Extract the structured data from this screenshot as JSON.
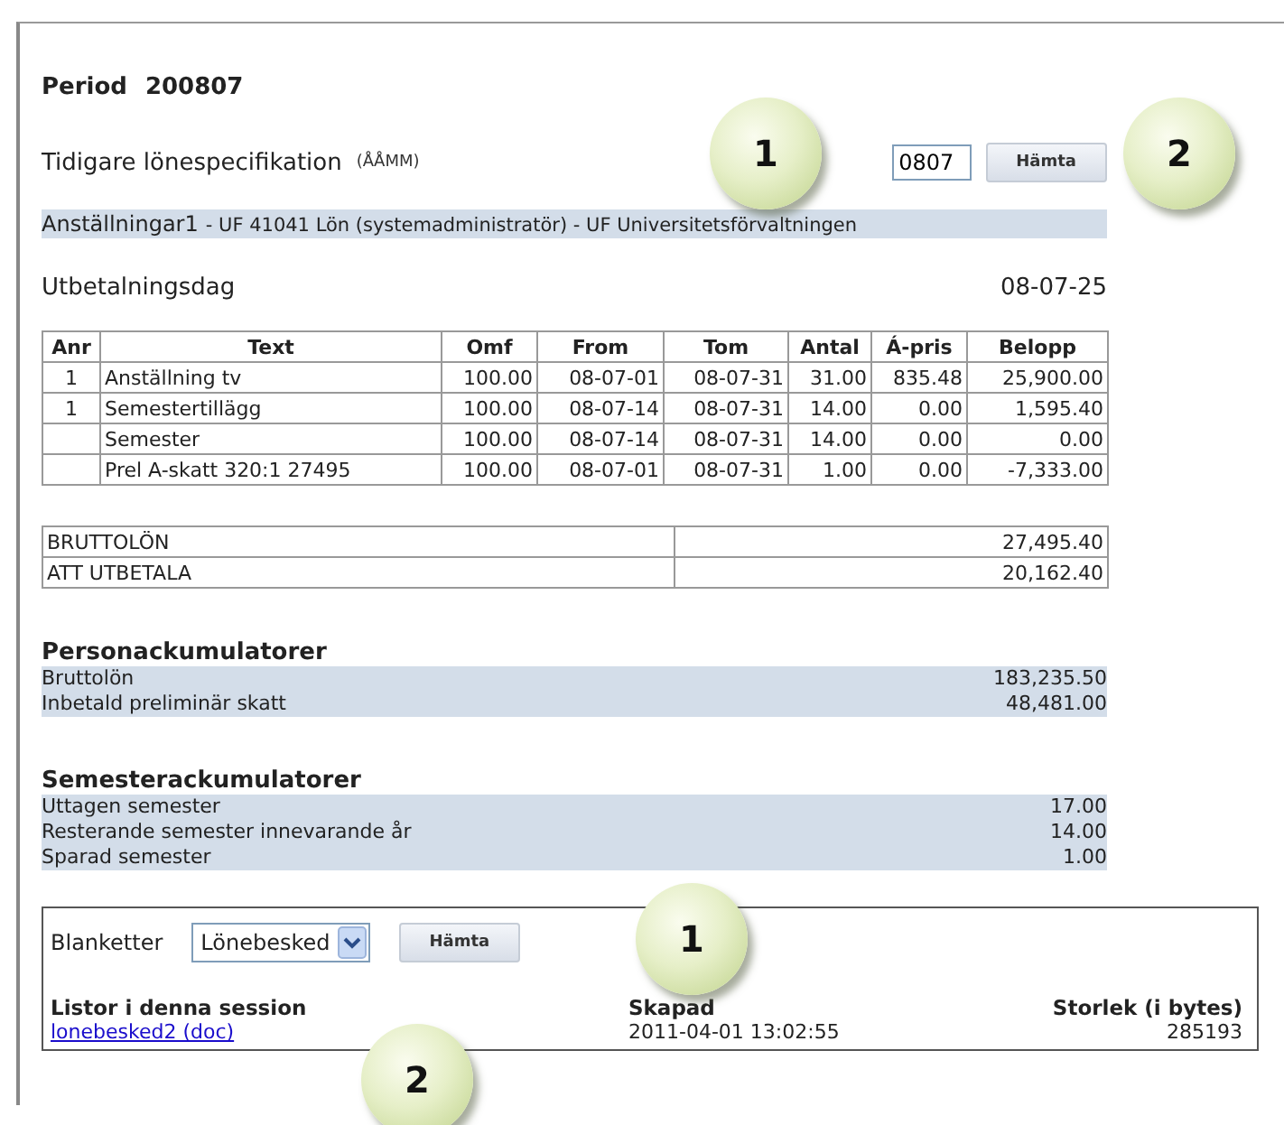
{
  "period": {
    "label": "Period",
    "value": "200807"
  },
  "earlier": {
    "label": "Tidigare lönespecifikation",
    "hint": "(ÅÅMM)",
    "value": "0807",
    "button": "Hämta"
  },
  "employment": {
    "title": "Anställningar1",
    "detail": "- UF 41041 Lön (systemadministratör) - UF Universitetsförvaltningen"
  },
  "payday": {
    "label": "Utbetalningsdag",
    "value": "08-07-25"
  },
  "table": {
    "columns": [
      "Anr",
      "Text",
      "Omf",
      "From",
      "Tom",
      "Antal",
      "Á-pris",
      "Belopp"
    ],
    "rows": [
      [
        "1",
        "Anställning tv",
        "100.00",
        "08-07-01",
        "08-07-31",
        "31.00",
        "835.48",
        "25,900.00"
      ],
      [
        "1",
        "Semestertillägg",
        "100.00",
        "08-07-14",
        "08-07-31",
        "14.00",
        "0.00",
        "1,595.40"
      ],
      [
        "",
        "Semester",
        "100.00",
        "08-07-14",
        "08-07-31",
        "14.00",
        "0.00",
        "0.00"
      ],
      [
        "",
        "Prel A-skatt 320:1 27495",
        "100.00",
        "08-07-01",
        "08-07-31",
        "1.00",
        "0.00",
        "-7,333.00"
      ]
    ]
  },
  "totals": [
    {
      "label": "BRUTTOLÖN",
      "value": "27,495.40"
    },
    {
      "label": "ATT UTBETALA",
      "value": "20,162.40"
    }
  ],
  "accumulators": [
    {
      "title": "Personackumulatorer",
      "rows": [
        {
          "label": "Bruttolön",
          "value": "183,235.50"
        },
        {
          "label": "Inbetald preliminär skatt",
          "value": "48,481.00"
        }
      ]
    },
    {
      "title": "Semesterackumulatorer",
      "rows": [
        {
          "label": "Uttagen semester",
          "value": "17.00"
        },
        {
          "label": "Resterande semester innevarande år",
          "value": "14.00"
        },
        {
          "label": "Sparad semester",
          "value": "1.00"
        }
      ]
    }
  ],
  "forms": {
    "label": "Blanketter",
    "select": "Lönebesked",
    "button": "Hämta",
    "columns": [
      "Listor i denna session",
      "Skapad",
      "Storlek (i bytes)"
    ],
    "files": [
      {
        "name": "lonebesked2 (doc)",
        "created": "2011-04-01 13:02:55",
        "size": "285193"
      }
    ]
  },
  "callouts": [
    {
      "label": "1"
    },
    {
      "label": "2"
    },
    {
      "label": "1"
    },
    {
      "label": "2"
    }
  ]
}
